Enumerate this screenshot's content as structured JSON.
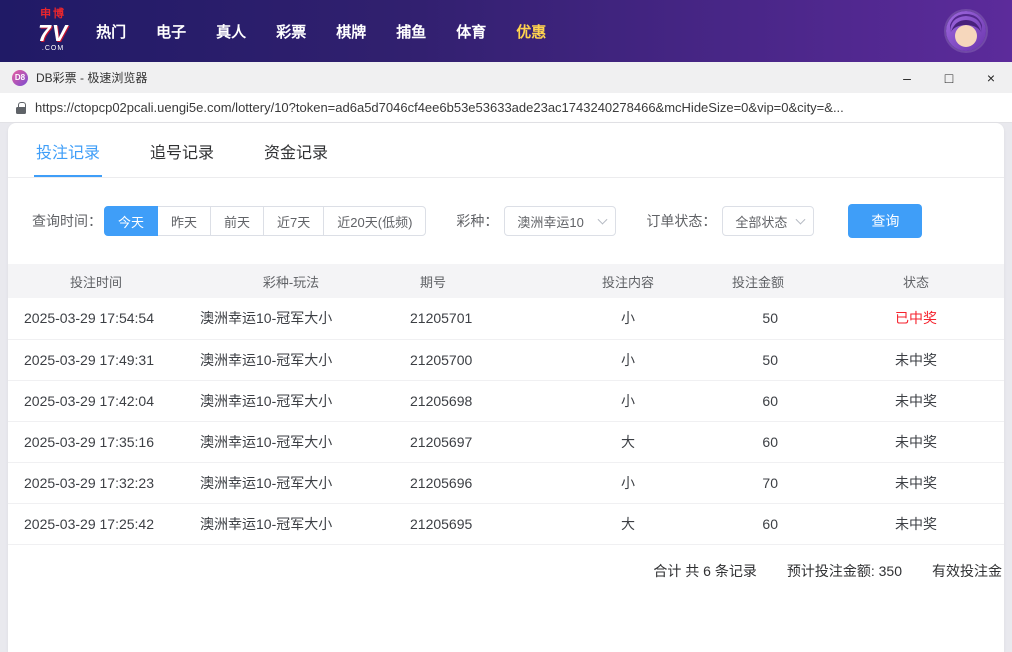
{
  "colors": {
    "accent": "#3f9ef8",
    "won": "#f5222d",
    "nav-highlight": "#ffd34e"
  },
  "topnav": {
    "logo": {
      "top": "申博",
      "main": "7V",
      "bottom": ".COM"
    },
    "items": [
      {
        "label": "热门"
      },
      {
        "label": "电子"
      },
      {
        "label": "真人"
      },
      {
        "label": "彩票"
      },
      {
        "label": "棋牌"
      },
      {
        "label": "捕鱼"
      },
      {
        "label": "体育"
      },
      {
        "label": "优惠"
      }
    ]
  },
  "window": {
    "app_icon_text": "D8",
    "title": "DB彩票 - 极速浏览器",
    "controls": {
      "minimize": "–",
      "maximize": "□",
      "close": "×"
    },
    "url": "https://ctopcp02pcali.uengi5e.com/lottery/10?token=ad6a5d7046cf4ee6b53e53633ade23ac1743240278466&mcHideSize=0&vip=0&city=&..."
  },
  "tabs": [
    {
      "label": "投注记录"
    },
    {
      "label": "追号记录"
    },
    {
      "label": "资金记录"
    }
  ],
  "filters": {
    "time_label": "查询时间：",
    "time_options": [
      {
        "label": "今天"
      },
      {
        "label": "昨天"
      },
      {
        "label": "前天"
      },
      {
        "label": "近7天"
      },
      {
        "label": "近20天(低频)"
      }
    ],
    "lottery_label": "彩种：",
    "lottery_value": "澳洲幸运10",
    "status_label": "订单状态：",
    "status_value": "全部状态",
    "query_button": "查询"
  },
  "table": {
    "headers": [
      "投注时间",
      "彩种-玩法",
      "期号",
      "投注内容",
      "投注金额",
      "状态"
    ],
    "rows": [
      {
        "time": "2025-03-29 17:54:54",
        "game": "澳洲幸运10-冠军大小",
        "issue": "21205701",
        "content": "小",
        "amount": "50",
        "status": "已中奖"
      },
      {
        "time": "2025-03-29 17:49:31",
        "game": "澳洲幸运10-冠军大小",
        "issue": "21205700",
        "content": "小",
        "amount": "50",
        "status": "未中奖"
      },
      {
        "time": "2025-03-29 17:42:04",
        "game": "澳洲幸运10-冠军大小",
        "issue": "21205698",
        "content": "小",
        "amount": "60",
        "status": "未中奖"
      },
      {
        "time": "2025-03-29 17:35:16",
        "game": "澳洲幸运10-冠军大小",
        "issue": "21205697",
        "content": "大",
        "amount": "60",
        "status": "未中奖"
      },
      {
        "time": "2025-03-29 17:32:23",
        "game": "澳洲幸运10-冠军大小",
        "issue": "21205696",
        "content": "小",
        "amount": "70",
        "status": "未中奖"
      },
      {
        "time": "2025-03-29 17:25:42",
        "game": "澳洲幸运10-冠军大小",
        "issue": "21205695",
        "content": "大",
        "amount": "60",
        "status": "未中奖"
      }
    ]
  },
  "summary": {
    "total": "合计 共 6 条记录",
    "expected": "预计投注金额: 350",
    "valid": "有效投注金"
  }
}
